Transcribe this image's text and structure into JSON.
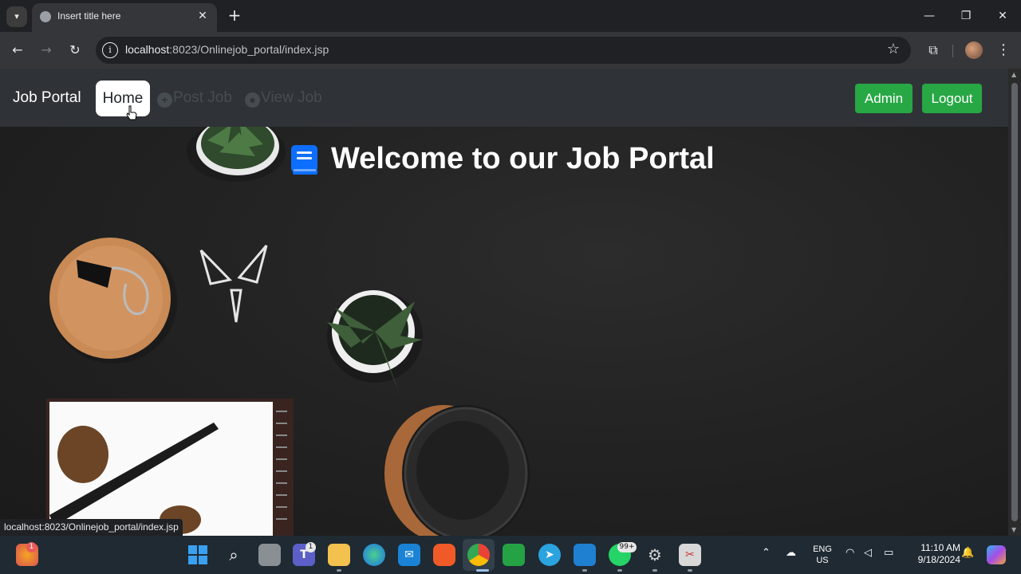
{
  "browser": {
    "tab_title": "Insert title here",
    "tab_close": "✕",
    "new_tab": "+",
    "url_host": "localhost",
    "url_rest": ":8023/Onlinejob_portal/index.jsp",
    "window_controls": {
      "minimize": "—",
      "restore": "❐",
      "close": "✕"
    },
    "status_bar_url": "localhost:8023/Onlinejob_portal/index.jsp"
  },
  "navbar": {
    "brand": "Job Portal",
    "links": [
      {
        "label": "Home",
        "icon": "none",
        "active": true
      },
      {
        "label": "Post Job",
        "icon": "plus-circle-icon",
        "active": false
      },
      {
        "label": "View Job",
        "icon": "eye-icon",
        "active": false
      }
    ],
    "buttons": {
      "admin": "Admin",
      "logout": "Logout"
    },
    "button_color": "#28a745"
  },
  "hero": {
    "title": "Welcome to our Job Portal",
    "icon": "book-icon",
    "icon_color": "#0d6efd"
  },
  "taskbar": {
    "lang_top": "ENG",
    "lang_bottom": "US",
    "time": "11:10 AM",
    "date": "9/18/2024",
    "weather_badge": "1",
    "teams_badge": "1",
    "whatsapp_badge": "99+"
  }
}
